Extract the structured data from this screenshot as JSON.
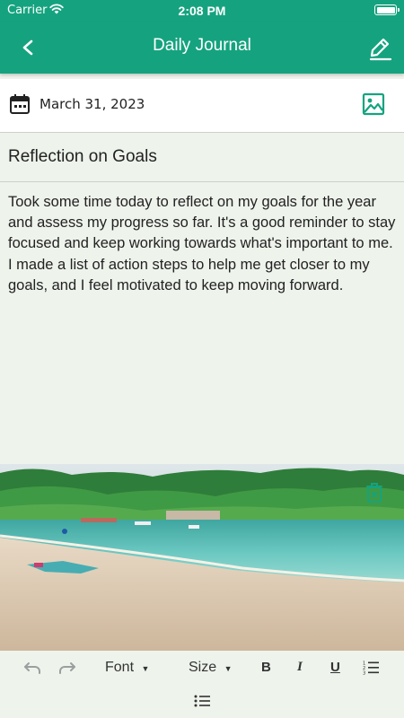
{
  "status": {
    "carrier": "Carrier",
    "time": "2:08 PM"
  },
  "nav": {
    "title": "Daily Journal",
    "back_icon": "chevron-left-icon",
    "edit_icon": "pencil-icon"
  },
  "entry": {
    "date": "March 31, 2023",
    "title": "Reflection on Goals",
    "body": "Took some time today to reflect on my goals for the year and assess my progress so far. It's a good reminder to stay focused and keep working towards what's important to me. I made a list of action steps to help me get closer to my goals, and I feel motivated to keep moving forward."
  },
  "photo": {
    "description_icon": "beach-photo",
    "delete_icon": "delete-image-icon"
  },
  "toolbar": {
    "undo_icon": "undo-icon",
    "redo_icon": "redo-icon",
    "font_label": "Font",
    "size_label": "Size",
    "bold_label": "B",
    "italic_label": "I",
    "underline_label": "U",
    "numbered_list_icon": "numbered-list-icon",
    "bullet_list_icon": "bullet-list-icon"
  },
  "colors": {
    "accent": "#15a37f",
    "background": "#eef3ec"
  }
}
